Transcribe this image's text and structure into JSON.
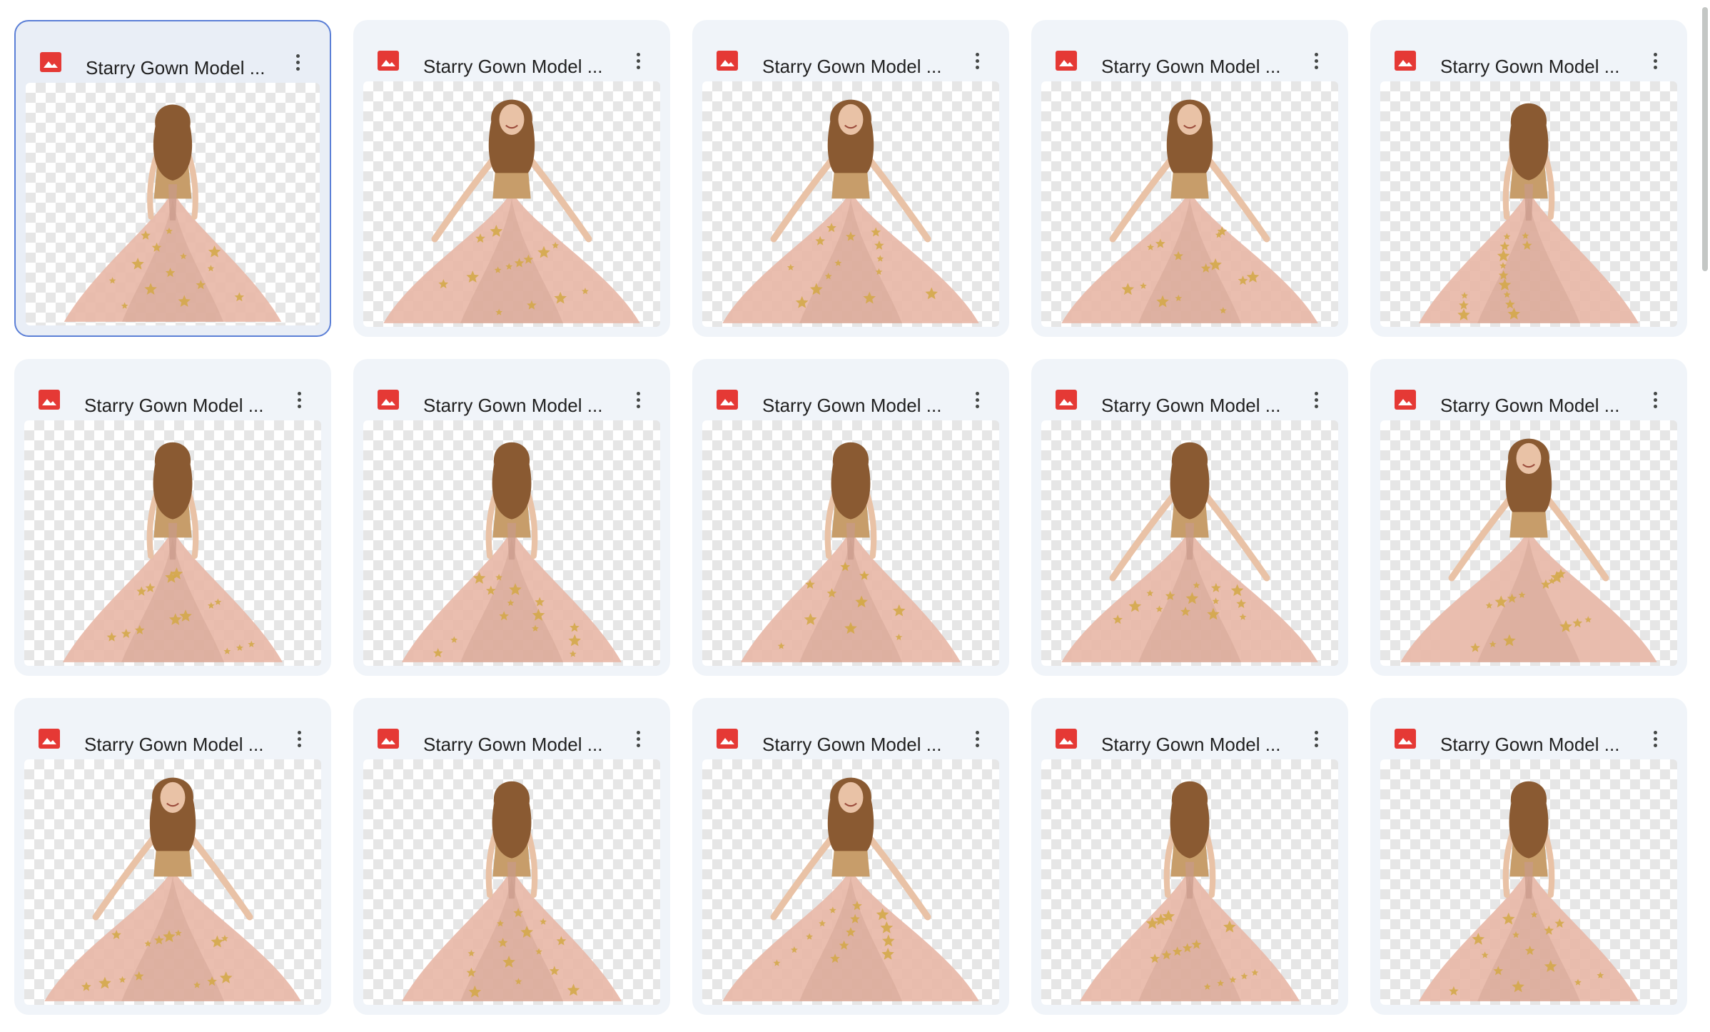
{
  "files": [
    {
      "name": "Starry Gown Model ...",
      "icon": "image-file-icon",
      "selected": true,
      "pose": "back",
      "arms": "down",
      "smile": false
    },
    {
      "name": "Starry Gown Model ...",
      "icon": "image-file-icon",
      "selected": false,
      "pose": "front",
      "arms": "spread",
      "smile": true
    },
    {
      "name": "Starry Gown Model ...",
      "icon": "image-file-icon",
      "selected": false,
      "pose": "front",
      "arms": "spread",
      "smile": true
    },
    {
      "name": "Starry Gown Model ...",
      "icon": "image-file-icon",
      "selected": false,
      "pose": "front",
      "arms": "spread",
      "smile": true
    },
    {
      "name": "Starry Gown Model ...",
      "icon": "image-file-icon",
      "selected": false,
      "pose": "back",
      "arms": "down",
      "smile": false
    },
    {
      "name": "Starry Gown Model ...",
      "icon": "image-file-icon",
      "selected": false,
      "pose": "back",
      "arms": "down",
      "smile": false
    },
    {
      "name": "Starry Gown Model ...",
      "icon": "image-file-icon",
      "selected": false,
      "pose": "back",
      "arms": "down",
      "smile": false
    },
    {
      "name": "Starry Gown Model ...",
      "icon": "image-file-icon",
      "selected": false,
      "pose": "back",
      "arms": "down",
      "smile": false
    },
    {
      "name": "Starry Gown Model ...",
      "icon": "image-file-icon",
      "selected": false,
      "pose": "back",
      "arms": "spread",
      "smile": false
    },
    {
      "name": "Starry Gown Model ...",
      "icon": "image-file-icon",
      "selected": false,
      "pose": "front",
      "arms": "spread",
      "smile": true
    },
    {
      "name": "Starry Gown Model ...",
      "icon": "image-file-icon",
      "selected": false,
      "pose": "front",
      "arms": "spread",
      "smile": true
    },
    {
      "name": "Starry Gown Model ...",
      "icon": "image-file-icon",
      "selected": false,
      "pose": "back",
      "arms": "down",
      "smile": false
    },
    {
      "name": "Starry Gown Model ...",
      "icon": "image-file-icon",
      "selected": false,
      "pose": "front",
      "arms": "spread",
      "smile": true
    },
    {
      "name": "Starry Gown Model ...",
      "icon": "image-file-icon",
      "selected": false,
      "pose": "back",
      "arms": "down",
      "smile": false
    },
    {
      "name": "Starry Gown Model ...",
      "icon": "image-file-icon",
      "selected": false,
      "pose": "back",
      "arms": "down",
      "smile": false
    }
  ],
  "colors": {
    "file_icon": "#e53935",
    "card_bg": "#f0f4f9",
    "selected_border": "#5b7fd6",
    "gown": "#e8b9a8",
    "gown_shadow": "#c99a8a",
    "bodice": "#c79d6a",
    "hair": "#8a5a32",
    "skin": "#e9c2a6",
    "stars": "#d4a84a"
  }
}
